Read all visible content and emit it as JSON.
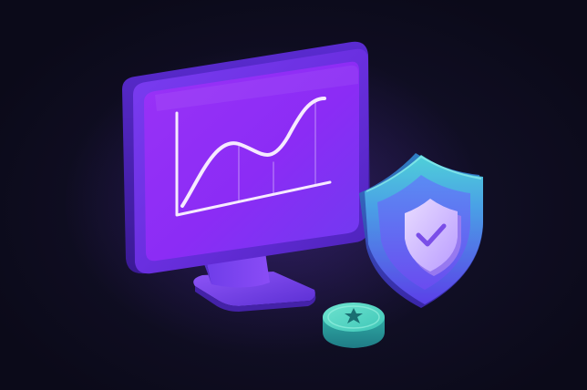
{
  "illustration": {
    "background_color": "#0b0a19",
    "monitor": {
      "icon": "monitor-icon",
      "screen_color": "#8b2cf5",
      "chart_icon": "line-chart-icon"
    },
    "shield": {
      "icon": "shield-check-icon",
      "color_top": "#4fd1d8",
      "color_bottom": "#6a4cf0"
    },
    "coin": {
      "icon": "star-coin-icon",
      "color": "#3fc7b8"
    }
  }
}
